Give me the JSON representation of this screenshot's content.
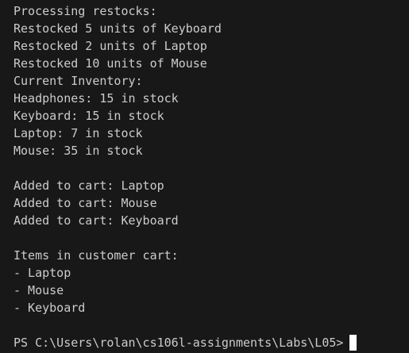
{
  "terminal": {
    "lines": [
      "Processing restocks:",
      "Restocked 5 units of Keyboard",
      "Restocked 2 units of Laptop",
      "Restocked 10 units of Mouse",
      "Current Inventory:",
      "Headphones: 15 in stock",
      "Keyboard: 15 in stock",
      "Laptop: 7 in stock",
      "Mouse: 35 in stock",
      "",
      "Added to cart: Laptop",
      "Added to cart: Mouse",
      "Added to cart: Keyboard",
      "",
      "Items in customer cart:",
      "- Laptop",
      "- Mouse",
      "- Keyboard",
      ""
    ],
    "prompt": "PS C:\\Users\\rolan\\cs106l-assignments\\Labs\\L05>"
  },
  "colors": {
    "background": "#181818",
    "text": "#cccccc",
    "cursor": "#ffffff"
  }
}
